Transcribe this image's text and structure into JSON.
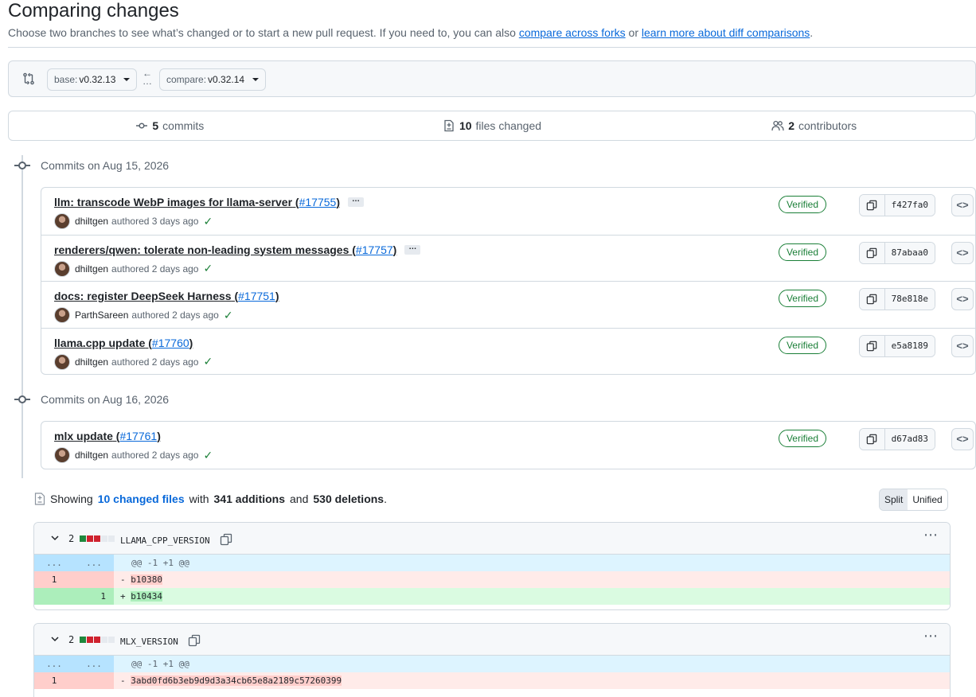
{
  "header": {
    "title": "Comparing changes",
    "subtitle_prefix": "Choose two branches to see what’s changed or to start a new pull request. If you need to, you can also",
    "link_forks": "compare across forks",
    "subtitle_or": "or",
    "link_learn": "learn more about diff comparisons",
    "subtitle_suffix": "."
  },
  "range": {
    "base_label": "base:",
    "base_value": "v0.32.13",
    "compare_label": "compare:",
    "compare_value": "v0.32.14"
  },
  "stats": {
    "commits_count": "5",
    "commits_label": "commits",
    "files_count": "10",
    "files_label": "files changed",
    "contributors_count": "2",
    "contributors_label": "contributors"
  },
  "days": [
    {
      "label": "Commits on Aug 15, 2026",
      "commits": [
        {
          "message": "llm: transcode WebP images for llama-server",
          "pr": "#17755",
          "has_more": true,
          "author": "dhiltgen",
          "authored": "authored 3 days ago",
          "verified": "Verified",
          "sha": "f427fa0"
        },
        {
          "message": "renderers/qwen: tolerate non-leading system messages",
          "pr": "#17757",
          "has_more": true,
          "author": "dhiltgen",
          "authored": "authored 2 days ago",
          "verified": "Verified",
          "sha": "87abaa0"
        },
        {
          "message": "docs: register DeepSeek Harness",
          "pr": "#17751",
          "has_more": false,
          "author": "ParthSareen",
          "authored": "authored 2 days ago",
          "verified": "Verified",
          "sha": "78e818e"
        },
        {
          "message": "llama.cpp update",
          "pr": "#17760",
          "has_more": false,
          "author": "dhiltgen",
          "authored": "authored 2 days ago",
          "verified": "Verified",
          "sha": "e5a8189"
        }
      ]
    },
    {
      "label": "Commits on Aug 16, 2026",
      "commits": [
        {
          "message": "mlx update",
          "pr": "#17761",
          "has_more": false,
          "author": "dhiltgen",
          "authored": "authored 2 days ago",
          "verified": "Verified",
          "sha": "d67ad83"
        }
      ]
    }
  ],
  "summary": {
    "showing": "Showing",
    "changed_files": "10 changed files",
    "with": "with",
    "additions": "341 additions",
    "and": "and",
    "deletions": "530 deletions",
    "period": "."
  },
  "view_toggle": {
    "split": "Split",
    "unified": "Unified",
    "selected": "Split"
  },
  "files": [
    {
      "count": "2",
      "name": "LLAMA_CPP_VERSION",
      "hunk_left": "...",
      "hunk_right": "...",
      "hunk": "@@ -1 +1 @@",
      "lines": [
        {
          "type": "del",
          "old": "1",
          "new": "",
          "sign": "-",
          "text": "b10380"
        },
        {
          "type": "add",
          "old": "",
          "new": "1",
          "sign": "+",
          "text": "b10434"
        }
      ]
    },
    {
      "count": "2",
      "name": "MLX_VERSION",
      "hunk_left": "...",
      "hunk_right": "...",
      "hunk": "@@ -1 +1 @@",
      "lines": [
        {
          "type": "del",
          "old": "1",
          "new": "",
          "sign": "-",
          "text": "3abd0fd6b3eb9d9d3a34cb65e8a2189c57260399"
        }
      ]
    }
  ],
  "colors": {
    "accent": "#0969da",
    "success": "#1a7f37",
    "danger": "#cf222e",
    "border": "#d1d9e0"
  }
}
